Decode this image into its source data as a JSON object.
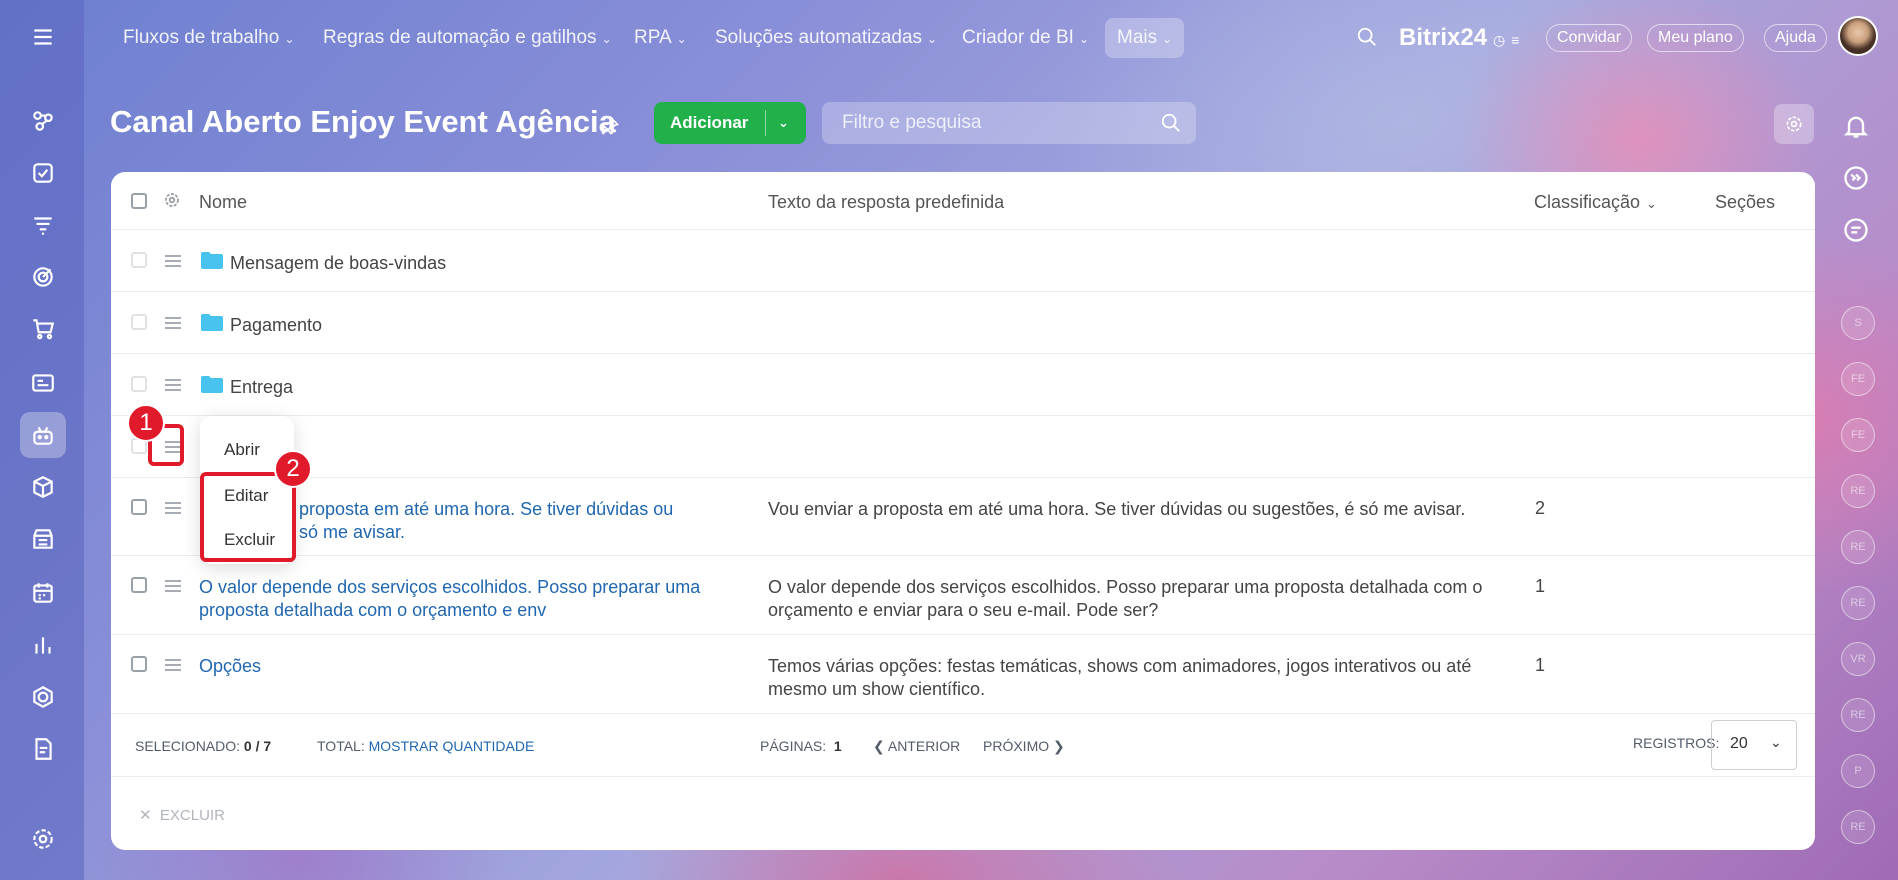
{
  "topnav": {
    "items": [
      {
        "label": "Fluxos de trabalho"
      },
      {
        "label": "Regras de automação e gatilhos"
      },
      {
        "label": "RPA"
      },
      {
        "label": "Soluções automatizadas"
      },
      {
        "label": "Criador de BI"
      },
      {
        "label": "Mais"
      }
    ],
    "logo": "Bitrix24",
    "invite": "Convidar",
    "plan": "Meu plano",
    "help": "Ajuda"
  },
  "sidebar": {
    "icons": [
      "menu-icon",
      "activity-icon",
      "tasks-icon",
      "filter-funnel-icon",
      "target-icon",
      "cart-icon",
      "card-icon",
      "bot-icon",
      "box-icon",
      "store-icon",
      "calendar-icon",
      "chart-icon",
      "hexagon-icon",
      "document-icon",
      "settings-icon"
    ]
  },
  "right_rail": {
    "avatars": [
      "S",
      "FE",
      "FE",
      "RE",
      "RE",
      "RE",
      "VR",
      "RE",
      "P",
      "RE"
    ]
  },
  "page": {
    "title": "Canal Aberto Enjoy Event Agência",
    "add_label": "Adicionar",
    "search_placeholder": "Filtro e pesquisa"
  },
  "table": {
    "headers": {
      "name": "Nome",
      "text": "Texto da resposta predefinida",
      "sort": "Classificação",
      "sections": "Seções"
    },
    "rows": [
      {
        "type": "folder",
        "name": "Mensagem de boas-vindas"
      },
      {
        "type": "folder",
        "name": "Pagamento"
      },
      {
        "type": "folder",
        "name": "Entrega"
      },
      {
        "type": "folder",
        "name": ""
      },
      {
        "type": "item",
        "name_l1": "proposta em até uma hora. Se tiver dúvidas ou",
        "name_l2": "só me avisar.",
        "text_l1": "Vou enviar a proposta em até uma hora. Se tiver dúvidas ou sugestões, é só me avisar.",
        "text_l2": "",
        "sort": "2"
      },
      {
        "type": "item",
        "name_l1": "O valor depende dos serviços escolhidos. Posso preparar uma",
        "name_l2": "proposta detalhada com o orçamento e env",
        "text_l1": "O valor depende dos serviços escolhidos. Posso preparar uma proposta detalhada com o",
        "text_l2": "orçamento e enviar para o seu e-mail. Pode ser?",
        "sort": "1"
      },
      {
        "type": "item",
        "name_l1": "Opções",
        "name_l2": "",
        "text_l1": "Temos várias opções: festas temáticas, shows com animadores, jogos interativos ou até",
        "text_l2": "mesmo um show científico.",
        "sort": "1"
      }
    ]
  },
  "footer": {
    "selected_label": "SELECIONADO:",
    "selected_value": "0 / 7",
    "total_label": "TOTAL:",
    "total_link": "MOSTRAR QUANTIDADE",
    "pages_label": "PÁGINAS:",
    "pages_value": "1",
    "prev": "ANTERIOR",
    "next": "PRÓXIMO",
    "records_label": "REGISTROS:",
    "records_value": "20",
    "delete": "EXCLUIR"
  },
  "context_menu": {
    "open": "Abrir",
    "edit": "Editar",
    "delete": "Excluir"
  },
  "annotations": {
    "badge1": "1",
    "badge2": "2",
    "color": "#e11a2b"
  }
}
